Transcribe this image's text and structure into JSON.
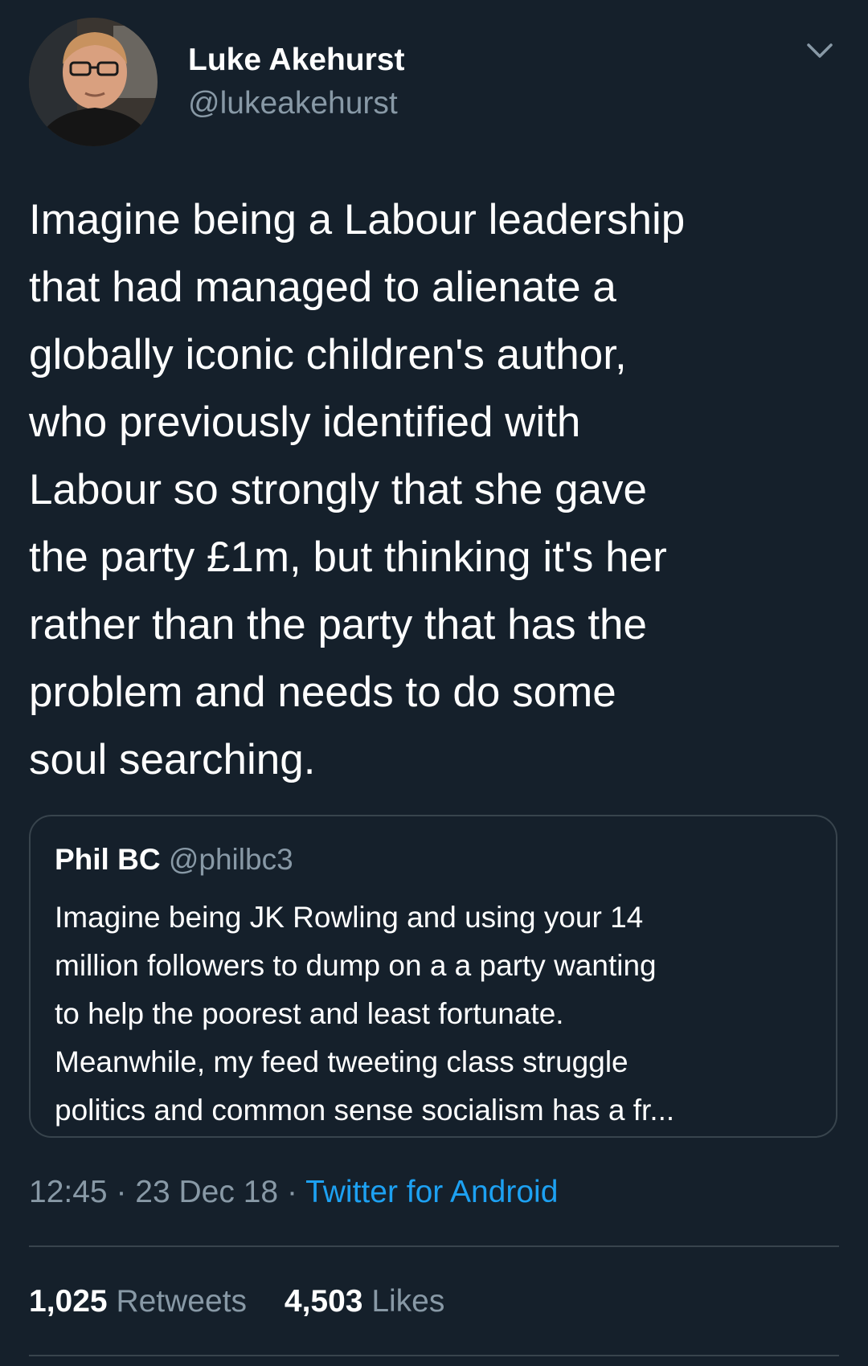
{
  "tweet": {
    "author": {
      "display_name": "Luke Akehurst",
      "handle": "@lukeakehurst"
    },
    "text": "Imagine being a Labour leadership\nthat had managed to alienate a\nglobally iconic children's author,\nwho previously identified with\nLabour so strongly that she gave\nthe party £1m, but thinking it's her\nrather than the party that has the\nproblem and needs to do some\nsoul searching.",
    "quoted": {
      "display_name": "Phil BC",
      "handle": "@philbc3",
      "text": "Imagine being JK Rowling and using your 14\nmillion followers to dump on a a party wanting\nto help the poorest and least fortunate.\nMeanwhile, my feed tweeting class struggle\npolitics and common sense socialism has a fr..."
    },
    "time": "12:45",
    "date": "23 Dec 18",
    "separator": "·",
    "source": "Twitter for Android",
    "stats": {
      "retweets_count": "1,025",
      "retweets_label": "Retweets",
      "likes_count": "4,503",
      "likes_label": "Likes"
    }
  },
  "colors": {
    "background": "#15202b",
    "text_primary": "#ffffff",
    "text_secondary": "#8899a6",
    "accent": "#1da1f2",
    "border": "#38444d"
  },
  "icons": {
    "menu": "chevron-down-icon",
    "avatar": "profile-photo"
  }
}
